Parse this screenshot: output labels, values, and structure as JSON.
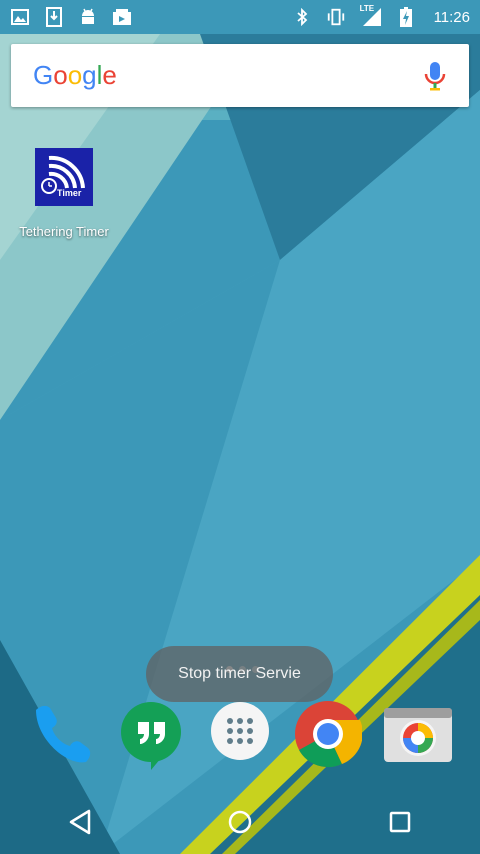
{
  "status_bar": {
    "time": "11:26",
    "network_label": "LTE",
    "left_icons": [
      "image-icon",
      "download-icon",
      "android-icon",
      "photos-icon"
    ],
    "right_icons": [
      "bluetooth-icon",
      "vibrate-icon",
      "signal-icon",
      "battery-charging-icon"
    ]
  },
  "search": {
    "logo": "Google",
    "mic_icon": "mic-icon"
  },
  "desktop": {
    "apps": [
      {
        "label": "Tethering Timer",
        "icon_text": "Timer",
        "icon": "wifi-timer-icon"
      }
    ]
  },
  "toast": {
    "message": "Stop timer Servie"
  },
  "dock": {
    "items": [
      "phone-icon",
      "hangouts-icon",
      "app-drawer-icon",
      "chrome-icon",
      "camera-icon"
    ]
  },
  "nav": {
    "items": [
      "back-icon",
      "home-icon",
      "recents-icon"
    ]
  },
  "colors": {
    "wallpaper_base": "#3f9fbd",
    "wallpaper_light": "#8cc7c9",
    "wallpaper_dark": "#1f6f8b",
    "accent_yellow": "#c8d21e",
    "app_icon_bg": "#1a22a8"
  }
}
